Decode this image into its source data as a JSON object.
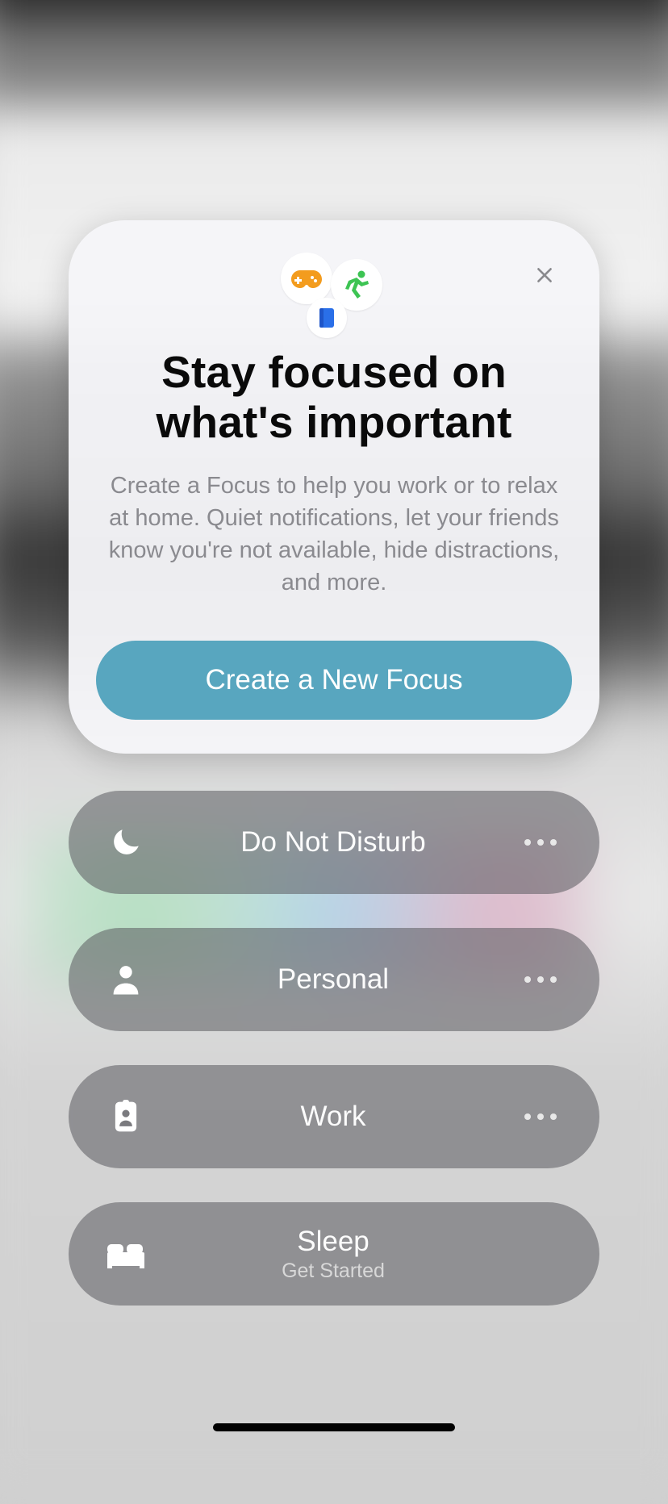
{
  "card": {
    "title": "Stay focused on what's important",
    "description": "Create a Focus to help you work or to relax at home. Quiet notifications, let your friends know you're not available, hide distractions, and more.",
    "cta_label": "Create a New Focus",
    "icons": [
      "game-controller",
      "fitness",
      "book"
    ]
  },
  "modes": [
    {
      "icon": "moon",
      "label": "Do Not Disturb",
      "sublabel": ""
    },
    {
      "icon": "person",
      "label": "Personal",
      "sublabel": ""
    },
    {
      "icon": "badge",
      "label": "Work",
      "sublabel": ""
    },
    {
      "icon": "bed",
      "label": "Sleep",
      "sublabel": "Get Started"
    }
  ],
  "colors": {
    "accent": "#58a6bf",
    "game": "#f39c1e",
    "fitness": "#3dc453",
    "book": "#2a6fe8"
  }
}
